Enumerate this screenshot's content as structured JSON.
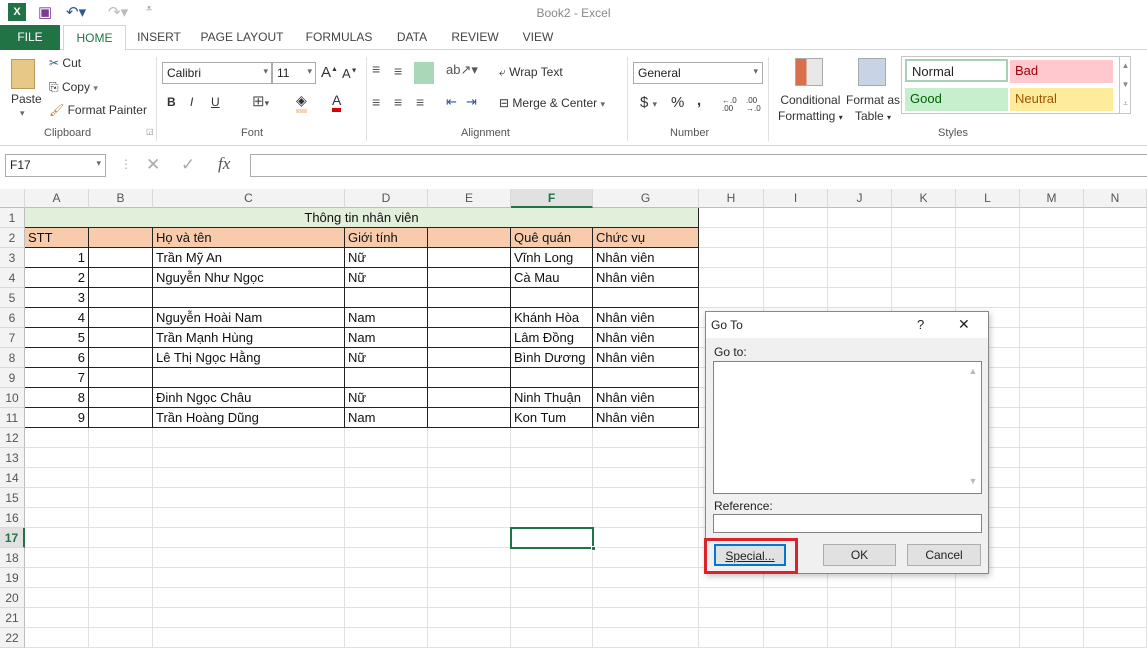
{
  "window": {
    "title": "Book2 - Excel"
  },
  "tabs": [
    "FILE",
    "HOME",
    "INSERT",
    "PAGE LAYOUT",
    "FORMULAS",
    "DATA",
    "REVIEW",
    "VIEW"
  ],
  "ribbon": {
    "clipboard": {
      "paste": "Paste",
      "cut": "Cut",
      "copy": "Copy",
      "format_painter": "Format Painter",
      "label": "Clipboard"
    },
    "font": {
      "name": "Calibri",
      "size": "11",
      "bold": "B",
      "italic": "I",
      "underline": "U",
      "label": "Font"
    },
    "alignment": {
      "wrap": "Wrap Text",
      "merge": "Merge & Center",
      "label": "Alignment"
    },
    "number": {
      "format": "General",
      "currency": "$",
      "percent": "%",
      "comma": ",",
      "inc": "←.0 .00",
      "dec": ".00 →.0",
      "label": "Number"
    },
    "styles": {
      "conditional": "Conditional",
      "conditional2": "Formatting",
      "format_table": "Format as",
      "format_table2": "Table",
      "normal": "Normal",
      "bad": "Bad",
      "good": "Good",
      "neutral": "Neutral",
      "label": "Styles"
    }
  },
  "formula_bar": {
    "name_box": "F17",
    "fx": "fx",
    "value": ""
  },
  "sheet": {
    "columns": [
      "A",
      "B",
      "C",
      "D",
      "E",
      "F",
      "G",
      "H",
      "I",
      "J",
      "K",
      "L",
      "M",
      "N"
    ],
    "selected_column": "F",
    "selected_row": 17,
    "active_cell": "F17",
    "title": "Thông tin nhân viên",
    "headers": [
      "STT",
      "",
      "Họ và tên",
      "Giới tính",
      "",
      "Quê quán",
      "Chức vụ"
    ],
    "rows": [
      [
        "1",
        "",
        "Trần Mỹ An",
        "Nữ",
        "",
        "Vĩnh Long",
        "Nhân viên"
      ],
      [
        "2",
        "",
        "Nguyễn Như Ngọc",
        "Nữ",
        "",
        "Cà Mau",
        "Nhân viên"
      ],
      [
        "3",
        "",
        "",
        "",
        "",
        "",
        ""
      ],
      [
        "4",
        "",
        "Nguyễn Hoài Nam",
        "Nam",
        "",
        "Khánh Hòa",
        "Nhân viên"
      ],
      [
        "5",
        "",
        "Trần Mạnh Hùng",
        "Nam",
        "",
        "Lâm Đồng",
        "Nhân viên"
      ],
      [
        "6",
        "",
        "Lê Thị Ngọc Hằng",
        "Nữ",
        "",
        "Bình Dương",
        "Nhân viên"
      ],
      [
        "7",
        "",
        "",
        "",
        "",
        "",
        ""
      ],
      [
        "8",
        "",
        "Đinh Ngọc Châu",
        "Nữ",
        "",
        "Ninh Thuận",
        "Nhân viên"
      ],
      [
        "9",
        "",
        "Trần Hoàng Dũng",
        "Nam",
        "",
        "Kon Tum",
        "Nhân viên"
      ]
    ],
    "colors": {
      "title_fill": "#e2efda",
      "header_fill": "#f8cbad",
      "accent": "#217346"
    }
  },
  "dialog": {
    "title": "Go To",
    "help": "?",
    "close": "✕",
    "goto_label": "Go to:",
    "reference_label": "Reference:",
    "reference_value": "",
    "special": "Special...",
    "ok": "OK",
    "cancel": "Cancel",
    "highlight_color": "#d9232d"
  }
}
